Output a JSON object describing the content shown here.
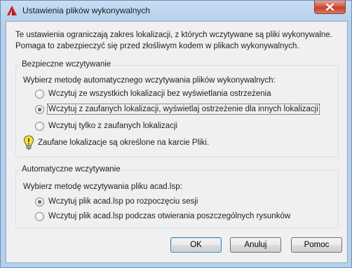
{
  "window": {
    "title": "Ustawienia plików wykonywalnych",
    "icon": "autocad-logo-icon",
    "close_icon": "close-icon"
  },
  "intro_text": "Te ustawienia ograniczają zakres lokalizacji, z których wczytywane są pliki wykonywalne. Pomaga to zabezpieczyć się przed złośliwym kodem w plikach wykonywalnych.",
  "secure_group": {
    "title": "Bezpieczne wczytywanie",
    "description": "Wybierz metodę automatycznego wczytywania plików wykonywalnych:",
    "options": [
      {
        "label": "Wczytuj ze wszystkich lokalizacji bez wyświetlania ostrzeżenia",
        "checked": false
      },
      {
        "label": "Wczytuj z zaufanych lokalizacji, wyświetlaj ostrzeżenie dla innych lokalizacji",
        "checked": true
      },
      {
        "label": "Wczytuj tylko z zaufanych lokalizacji",
        "checked": false
      }
    ],
    "note": "Zaufane lokalizacje są określone na karcie Pliki."
  },
  "auto_group": {
    "title": "Automatyczne wczytywanie",
    "description": "Wybierz metodę wczytywania pliku acad.lsp:",
    "options": [
      {
        "label": "Wczytuj plik acad.lsp po rozpoczęciu sesji",
        "checked": true
      },
      {
        "label": "Wczytuj plik acad.lsp podczas otwierania poszczególnych rysunków",
        "checked": false
      }
    ]
  },
  "buttons": {
    "ok": "OK",
    "cancel": "Anuluj",
    "help": "Pomoc"
  },
  "colors": {
    "title_gradient": "#b6d0ec",
    "close_button": "#c2402a",
    "client_bg": "#f0f0f0",
    "default_button_border": "#3c7fb1"
  }
}
